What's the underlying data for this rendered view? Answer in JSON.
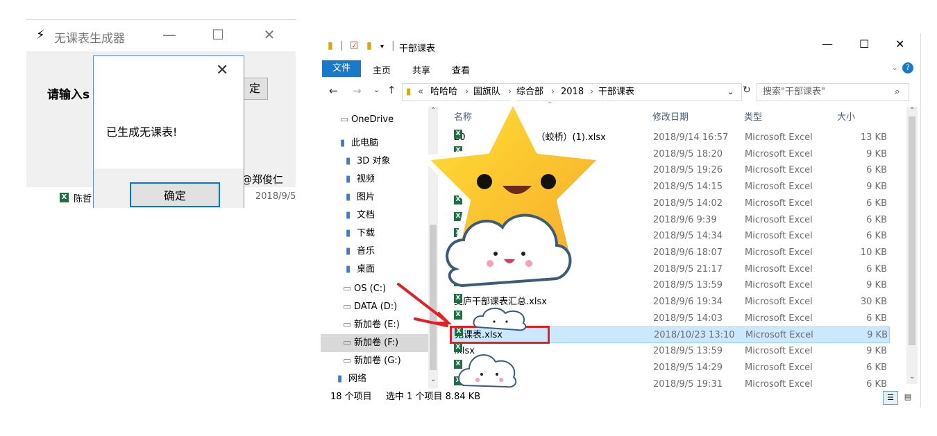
{
  "app": {
    "title": "无课表生成器",
    "min_glyph": "—",
    "max_glyph": "☐",
    "close_glyph": "✕",
    "prompt": "请输入s",
    "button_partial": "定",
    "author": "@郑俊仁",
    "file_row_name": "陈哲",
    "file_row_date": "2018/9/5"
  },
  "dialog": {
    "message": "已生成无课表!",
    "ok_label": "确定",
    "close_glyph": "✕"
  },
  "explorer": {
    "window_title": "干部课表",
    "min_glyph": "—",
    "max_glyph": "☐",
    "close_glyph": "✕",
    "ribbon": {
      "file": "文件",
      "home": "主页",
      "share": "共享",
      "view": "查看"
    },
    "breadcrumb": [
      "«",
      "哈哈哈",
      "国旗队",
      "综合部",
      "2018",
      "干部课表"
    ],
    "search_placeholder": "搜索\"干部课表\"",
    "nav_items": [
      {
        "label": "OneDrive",
        "icon": "onedrive-icon"
      },
      {
        "label": "此电脑",
        "icon": "computer-icon"
      },
      {
        "label": "3D 对象",
        "icon": "3d-objects-icon"
      },
      {
        "label": "视频",
        "icon": "video-icon"
      },
      {
        "label": "图片",
        "icon": "pictures-icon"
      },
      {
        "label": "文档",
        "icon": "documents-icon"
      },
      {
        "label": "下载",
        "icon": "downloads-icon"
      },
      {
        "label": "音乐",
        "icon": "music-icon"
      },
      {
        "label": "桌面",
        "icon": "desktop-icon"
      },
      {
        "label": "OS (C:)",
        "icon": "drive-icon"
      },
      {
        "label": "DATA (D:)",
        "icon": "drive-icon"
      },
      {
        "label": "新加卷 (E:)",
        "icon": "drive-icon"
      },
      {
        "label": "新加卷 (F:)",
        "icon": "drive-icon"
      },
      {
        "label": "新加卷 (G:)",
        "icon": "drive-icon"
      },
      {
        "label": "网络",
        "icon": "network-icon"
      }
    ],
    "columns": {
      "name": "名称",
      "date": "修改日期",
      "type": "类型",
      "size": "大小"
    },
    "files": [
      {
        "name": "20",
        "name_tail": "（蛟桥）(1).xlsx",
        "date": "2018/9/14 16:57",
        "type": "Microsoft Excel",
        "size": "13 KB"
      },
      {
        "name": "",
        "date": "2018/9/5 18:20",
        "type": "Microsoft Excel",
        "size": "9 KB"
      },
      {
        "name": "",
        "date": "2018/9/5 19:26",
        "type": "Microsoft Excel",
        "size": "6 KB"
      },
      {
        "name": "",
        "date": "2018/9/5 14:15",
        "type": "Microsoft Excel",
        "size": "9 KB"
      },
      {
        "name": "",
        "date": "2018/9/5 14:02",
        "type": "Microsoft Excel",
        "size": "6 KB"
      },
      {
        "name": "",
        "date": "2018/9/6 9:39",
        "type": "Microsoft Excel",
        "size": "6 KB"
      },
      {
        "name": "",
        "date": "2018/9/5 14:34",
        "type": "Microsoft Excel",
        "size": "6 KB"
      },
      {
        "name": "",
        "date": "2018/9/6 18:07",
        "type": "Microsoft Excel",
        "size": "10 KB"
      },
      {
        "name": "",
        "date": "2018/9/5 21:17",
        "type": "Microsoft Excel",
        "size": "6 KB"
      },
      {
        "name": "",
        "date": "2018/9/5 13:59",
        "type": "Microsoft Excel",
        "size": "9 KB"
      },
      {
        "name": "麦庐干部课表汇总.xlsx",
        "date": "2018/9/6 19:34",
        "type": "Microsoft Excel",
        "size": "30 KB"
      },
      {
        "name": "",
        "date": "2018/9/5 14:03",
        "type": "Microsoft Excel",
        "size": "6 KB"
      },
      {
        "name": "无课表.xlsx",
        "date": "2018/10/23 13:10",
        "type": "Microsoft Excel",
        "size": "9 KB",
        "selected": true
      },
      {
        "name": ".xlsx",
        "date": "2018/9/5 13:59",
        "type": "Microsoft Excel",
        "size": "9 KB"
      },
      {
        "name": "",
        "date": "2018/9/5 14:29",
        "type": "Microsoft Excel",
        "size": "6 KB"
      },
      {
        "name": "",
        "date": "2018/9/5 19:31",
        "type": "Microsoft Excel",
        "size": "6 KB"
      }
    ],
    "status_items": "18 个项目",
    "status_selected": "选中 1 个项目 8.84 KB",
    "accent_color": "#1979ca",
    "highlight_color": "#e52025"
  },
  "stickers": [
    "star-face",
    "cloud-face",
    "cloud-face-small",
    "cloud-face-small"
  ]
}
